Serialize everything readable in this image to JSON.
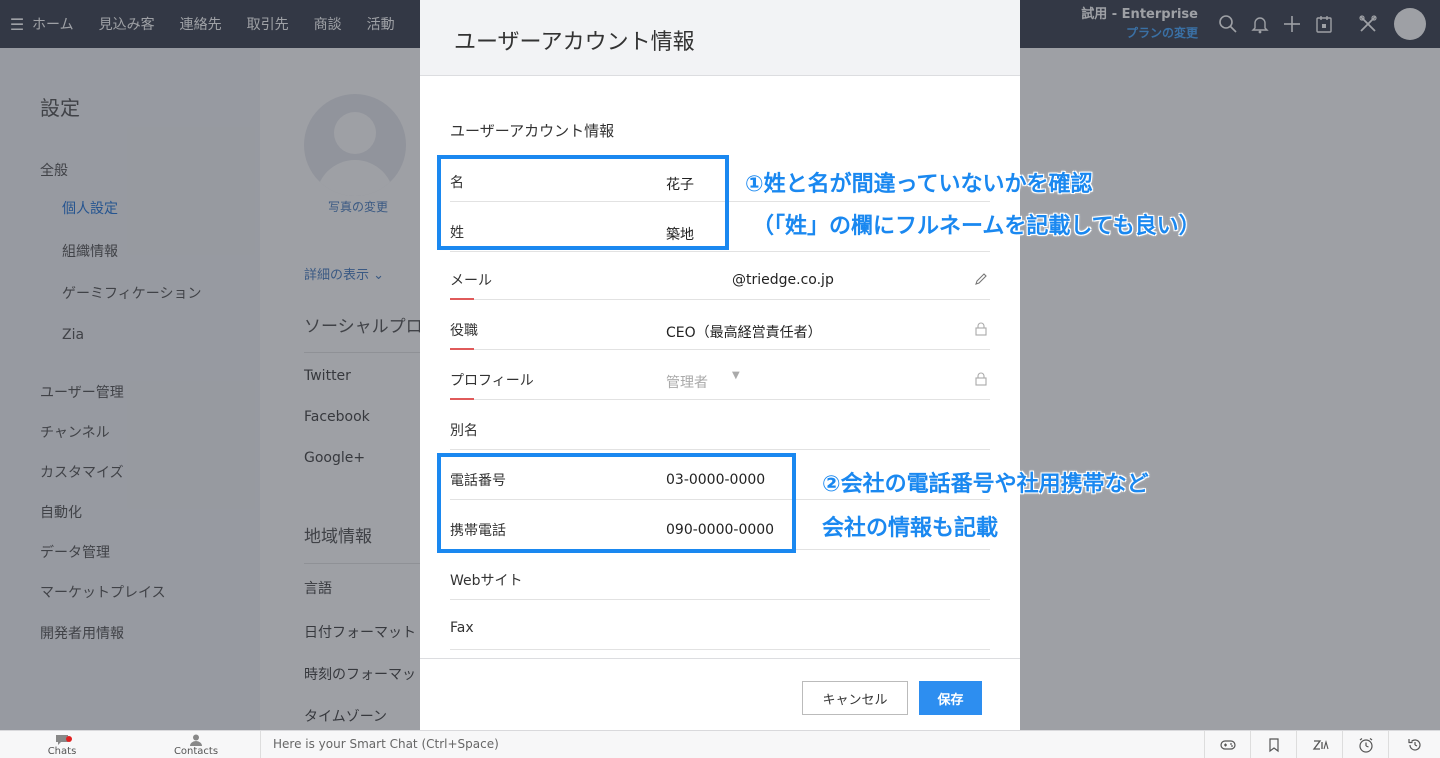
{
  "topbar": {
    "nav": [
      "ホーム",
      "見込み客",
      "連絡先",
      "取引先",
      "商談",
      "活動"
    ],
    "trial_label": "試用 - Enterprise",
    "upgrade_link": "プランの変更"
  },
  "sidebar": {
    "title": "設定",
    "general": "全般",
    "personal": "個人設定",
    "org": "組織情報",
    "gamification": "ゲーミフィケーション",
    "zia": "Zia",
    "users": "ユーザー管理",
    "channels": "チャンネル",
    "customize": "カスタマイズ",
    "automation": "自動化",
    "data": "データ管理",
    "marketplace": "マーケットプレイス",
    "developer": "開発者用情報"
  },
  "content": {
    "photo_change": "写真の変更",
    "show_details": "詳細の表示",
    "social_heading": "ソーシャルプロ",
    "twitter": "Twitter",
    "facebook": "Facebook",
    "google": "Google+",
    "locale_heading": "地域情報",
    "language": "言語",
    "date_format": "日付フォーマット",
    "time_format": "時刻のフォーマッ",
    "timezone": "タイムゾーン"
  },
  "modal": {
    "title": "ユーザーアカウント情報",
    "section": "ユーザーアカウント情報",
    "fields": {
      "first_name": {
        "label": "名",
        "value": "花子"
      },
      "last_name": {
        "label": "姓",
        "value": "築地"
      },
      "email": {
        "label": "メール",
        "value": "@triedge.co.jp"
      },
      "role": {
        "label": "役職",
        "value": "CEO（最高経営責任者）"
      },
      "profile": {
        "label": "プロフィール",
        "value": "管理者"
      },
      "alias": {
        "label": "別名",
        "value": ""
      },
      "phone": {
        "label": "電話番号",
        "value": "03-0000-0000"
      },
      "mobile": {
        "label": "携帯電話",
        "value": "090-0000-0000"
      },
      "website": {
        "label": "Webサイト",
        "value": ""
      },
      "fax": {
        "label": "Fax",
        "value": ""
      }
    },
    "cancel": "キャンセル",
    "save": "保存"
  },
  "annotations": {
    "note1_line1": "①姓と名が間違っていないかを確認",
    "note1_line2": "（「姓」の欄にフルネームを記載しても良い）",
    "note2_line1": "②会社の電話番号や社用携帯など",
    "note2_line2": "会社の情報も記載"
  },
  "bottombar": {
    "chats": "Chats",
    "contacts": "Contacts",
    "smartchat": "Here is your Smart Chat (Ctrl+Space)"
  },
  "colors": {
    "topbar": "#3c4350",
    "accent": "#2d8ef0",
    "annotation": "#1a88f0",
    "required": "#e05a5a"
  }
}
